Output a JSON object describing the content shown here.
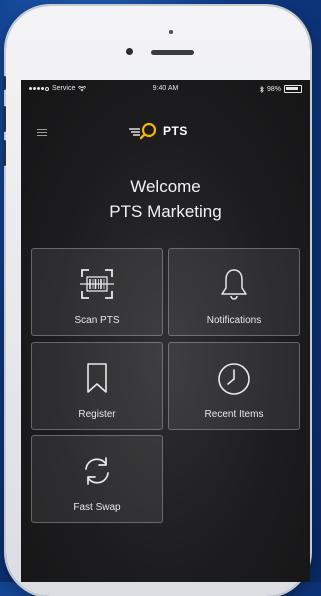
{
  "status_bar": {
    "carrier": "Service",
    "time": "9:40 AM",
    "battery": "98%"
  },
  "header": {
    "logo_text": "PTS",
    "menu_icon": "hamburger-menu-icon"
  },
  "welcome": {
    "line1": "Welcome",
    "line2": "PTS Marketing"
  },
  "tiles": [
    {
      "label": "Scan PTS",
      "icon": "barcode-scan-icon"
    },
    {
      "label": "Notifications",
      "icon": "bell-icon"
    },
    {
      "label": "Register",
      "icon": "bookmark-icon"
    },
    {
      "label": "Recent Items",
      "icon": "clock-icon"
    },
    {
      "label": "Fast Swap",
      "icon": "refresh-icon"
    }
  ],
  "colors": {
    "background_blue": "#0f3a86",
    "screen_dark": "#1d1d1f",
    "logo_accent": "#f5b400"
  }
}
